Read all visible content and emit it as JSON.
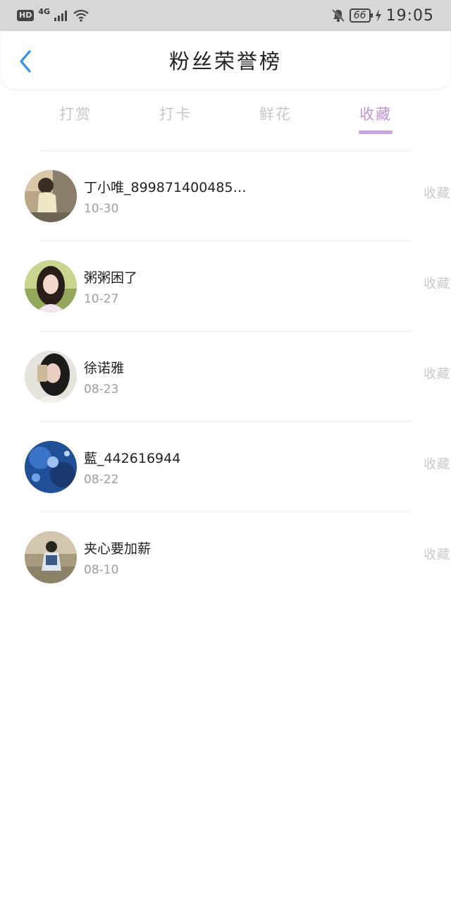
{
  "status_bar": {
    "hd": "HD",
    "network": "4G",
    "battery": "66",
    "time": "19:05"
  },
  "header": {
    "title": "粉丝荣誉榜",
    "back_icon": "chevron-left-icon",
    "accent_color": "#2d8ff0"
  },
  "tabs": [
    {
      "label": "打赏",
      "active": false
    },
    {
      "label": "打卡",
      "active": false
    },
    {
      "label": "鲜花",
      "active": false
    },
    {
      "label": "收藏",
      "active": true
    }
  ],
  "colors": {
    "active_tab": "#c191d9",
    "inactive_tab": "#c8c8c8"
  },
  "fans": [
    {
      "name": "丁小唯_8998714004852...",
      "date": "10-30",
      "action": "收藏"
    },
    {
      "name": "粥粥困了",
      "date": "10-27",
      "action": "收藏"
    },
    {
      "name": "徐诺雅",
      "date": "08-23",
      "action": "收藏"
    },
    {
      "name": "藍_442616944",
      "date": "08-22",
      "action": "收藏"
    },
    {
      "name": "夹心要加薪",
      "date": "08-10",
      "action": "收藏"
    }
  ]
}
